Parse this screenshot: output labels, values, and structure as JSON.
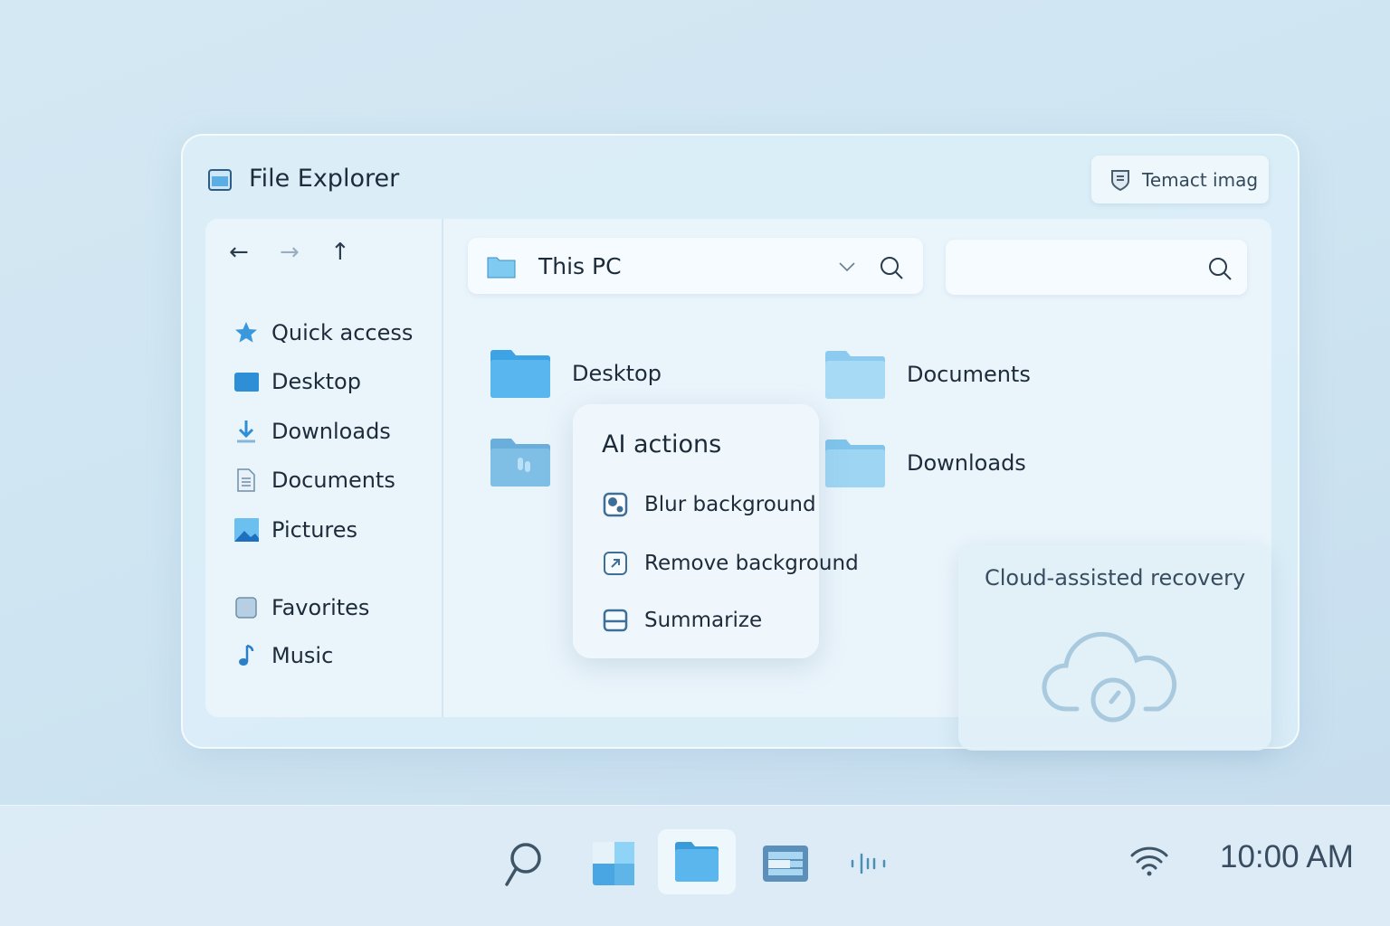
{
  "window": {
    "title": "File Explorer",
    "title_button": "Temact imag"
  },
  "nav": {
    "back": "←",
    "forward": "→",
    "up": "↑"
  },
  "sidebar": {
    "items": [
      {
        "label": "Quick access",
        "icon": "star-icon"
      },
      {
        "label": "Desktop",
        "icon": "desktop-folder-icon"
      },
      {
        "label": "Downloads",
        "icon": "download-icon"
      },
      {
        "label": "Documents",
        "icon": "document-icon"
      },
      {
        "label": "Pictures",
        "icon": "pictures-icon"
      },
      {
        "label": "Favorites",
        "icon": "favorites-icon"
      },
      {
        "label": "Music",
        "icon": "music-icon"
      }
    ]
  },
  "address": {
    "location": "This PC",
    "search_placeholder": ""
  },
  "folders": [
    {
      "label": "Desktop"
    },
    {
      "label": "Documents"
    },
    {
      "label": ""
    },
    {
      "label": "Downloads"
    }
  ],
  "context_menu": {
    "title": "AI actions",
    "items": [
      {
        "label": "Blur background"
      },
      {
        "label": "Remove background"
      },
      {
        "label": "Summarize"
      }
    ]
  },
  "cloud_card": {
    "title": "Cloud-assisted recovery"
  },
  "taskbar": {
    "time": "10:00 AM"
  },
  "colors": {
    "accent": "#3a9ad9",
    "folder": "#6fc0ec",
    "text": "#1d2b3a"
  }
}
